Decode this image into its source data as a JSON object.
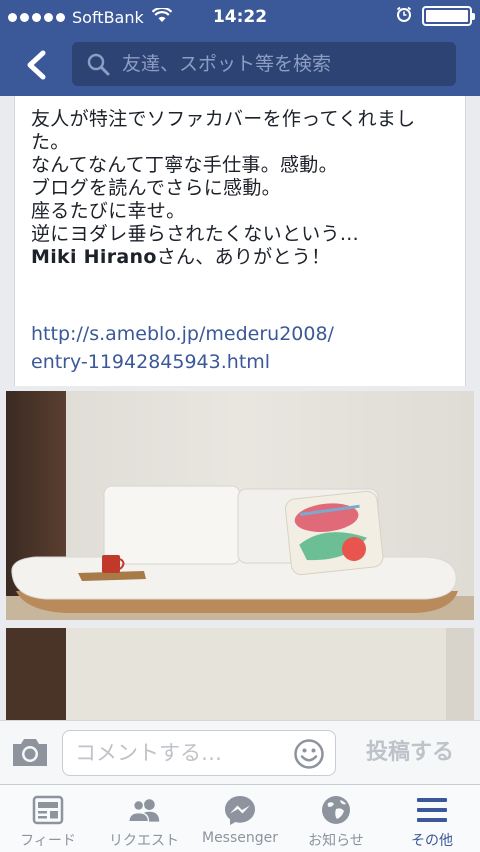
{
  "status_bar": {
    "carrier": "SoftBank",
    "time": "14:22",
    "battery_level": 1.0
  },
  "nav": {
    "back_icon": "chevron-left-icon",
    "search_placeholder": "友達、スポット等を検索"
  },
  "post": {
    "lines": [
      "友人が特注でソファカバーを作ってくれまし",
      "た。",
      "なんてなんて丁寧な手仕事。感動。",
      "ブログを読んでさらに感動。",
      "座るたびに幸せ。",
      "逆にヨダレ垂らされたくないという…"
    ],
    "tagged_name": "Miki Hirano",
    "thanks_suffix": "さん、ありがとう！",
    "link_line1": "http://s.ameblo.jp/mederu2008/",
    "link_line2": "entry-11942845943.html"
  },
  "comment_bar": {
    "placeholder": "コメントする…",
    "post_label": "投稿する"
  },
  "tabs": [
    {
      "label": "フィード",
      "icon": "news-feed-icon"
    },
    {
      "label": "リクエスト",
      "icon": "friend-requests-icon"
    },
    {
      "label": "Messenger",
      "icon": "messenger-icon"
    },
    {
      "label": "お知らせ",
      "icon": "notifications-globe-icon"
    },
    {
      "label": "その他",
      "icon": "menu-icon"
    }
  ],
  "colors": {
    "brand": "#3b5998",
    "inactive": "#8d949e"
  }
}
